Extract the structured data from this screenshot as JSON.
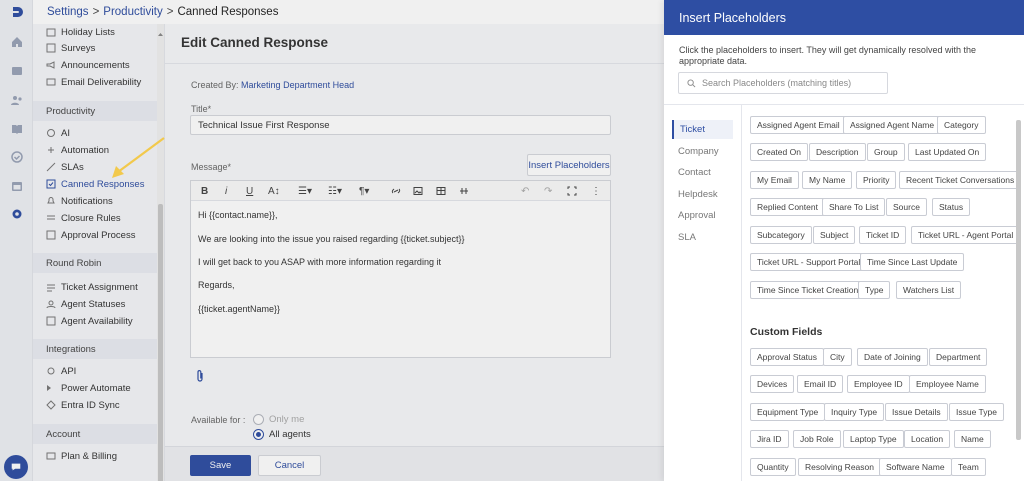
{
  "breadcrumb": {
    "items": [
      "Settings",
      "Productivity"
    ],
    "current": "Canned Responses",
    "separator": ">"
  },
  "rail": {
    "icons": [
      "logo-icon",
      "home-icon",
      "inbox-icon",
      "users-icon",
      "book-icon",
      "check-icon",
      "calendar-icon",
      "settings-icon"
    ]
  },
  "sidebar": {
    "top_items": [
      "Holiday Lists",
      "Surveys",
      "Announcements",
      "Email Deliverability"
    ],
    "productivity_header": "Productivity",
    "productivity_items": [
      "AI",
      "Automation",
      "SLAs",
      "Canned Responses",
      "Notifications",
      "Closure Rules",
      "Approval Process"
    ],
    "round_robin_header": "Round Robin",
    "round_robin_items": [
      "Ticket Assignment",
      "Agent Statuses",
      "Agent Availability"
    ],
    "integrations_header": "Integrations",
    "integrations_items": [
      "API",
      "Power Automate",
      "Entra ID Sync"
    ],
    "account_header": "Account",
    "account_items": [
      "Plan & Billing"
    ]
  },
  "editor": {
    "title": "Edit Canned Response",
    "created_by_label": "Created By:",
    "created_by_value": "Marketing Department Head",
    "title_label": "Title*",
    "title_value": "Technical Issue First Response",
    "message_label": "Message*",
    "insert_button": "Insert Placeholders",
    "message_lines": [
      "Hi {{contact.name}},",
      "We are looking into the issue you raised regarding {{ticket.subject}}",
      "I will get back to you ASAP with more information regarding it",
      "Regards,",
      "{{ticket.agentName}}"
    ],
    "available_for_label": "Available for :",
    "options": [
      "Only me",
      "All agents"
    ],
    "save_button": "Save",
    "cancel_button": "Cancel"
  },
  "panel": {
    "title": "Insert Placeholders",
    "description": "Click the placeholders to insert. They will get dynamically resolved with the appropriate data.",
    "search_placeholder": "Search Placeholders (matching titles)",
    "categories": [
      "Ticket",
      "Company",
      "Contact",
      "Helpdesk",
      "Approval",
      "SLA"
    ],
    "active_category": "Ticket",
    "ticket_placeholders": [
      "Assigned Agent Email",
      "Assigned Agent Name",
      "Category",
      "Created On",
      "Description",
      "Group",
      "Last Updated On",
      "My Email",
      "My Name",
      "Priority",
      "Recent Ticket Conversations",
      "Replied Content",
      "Share To List",
      "Source",
      "Status",
      "Subcategory",
      "Subject",
      "Ticket ID",
      "Ticket URL - Agent Portal",
      "Ticket URL - Support Portal",
      "Time Since Last Update",
      "Time Since Ticket Creation",
      "Type",
      "Watchers List"
    ],
    "custom_fields_header": "Custom Fields",
    "custom_placeholders": [
      "Approval Status",
      "City",
      "Date of Joining",
      "Department",
      "Devices",
      "Email ID",
      "Employee ID",
      "Employee Name",
      "Equipment Type",
      "Inquiry Type",
      "Issue Details",
      "Issue Type",
      "Jira ID",
      "Job Role",
      "Laptop Type",
      "Location",
      "Name",
      "Quantity",
      "Resolving Reason",
      "Software Name",
      "Team"
    ]
  },
  "colors": {
    "accent": "#2e4ea3",
    "annotation": "#f2c94c"
  }
}
